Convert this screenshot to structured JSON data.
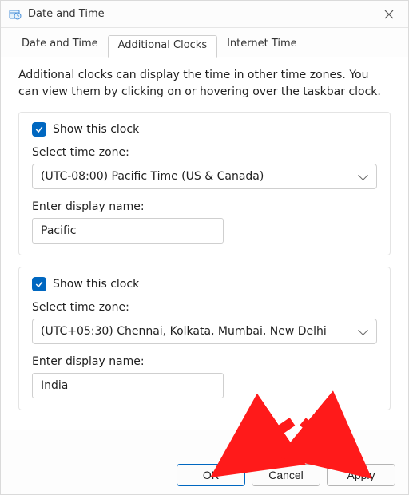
{
  "window": {
    "title": "Date and Time"
  },
  "tabs": {
    "dateTime": "Date and Time",
    "additionalClocks": "Additional Clocks",
    "internetTime": "Internet Time",
    "active": "additionalClocks"
  },
  "description": "Additional clocks can display the time in other time zones. You can view them by clicking on or hovering over the taskbar clock.",
  "clock1": {
    "showLabel": "Show this clock",
    "checked": true,
    "tzLabel": "Select time zone:",
    "tzValue": "(UTC-08:00) Pacific Time (US & Canada)",
    "nameLabel": "Enter display name:",
    "nameValue": "Pacific"
  },
  "clock2": {
    "showLabel": "Show this clock",
    "checked": true,
    "tzLabel": "Select time zone:",
    "tzValue": "(UTC+05:30) Chennai, Kolkata, Mumbai, New Delhi",
    "nameLabel": "Enter display name:",
    "nameValue": "India"
  },
  "buttons": {
    "ok": "OK",
    "cancel": "Cancel",
    "apply": "Apply"
  }
}
